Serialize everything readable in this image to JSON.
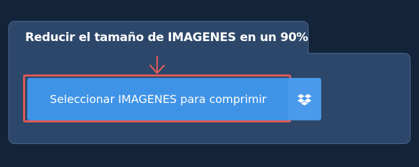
{
  "uploader": {
    "title": "Reducir el tamaño de IMAGENES en un 90%",
    "select_button_label": "Seleccionar IMAGENES para comprimir",
    "dropbox_icon": "dropbox-icon",
    "arrow_icon": "arrow-down-icon"
  },
  "colors": {
    "background": "#13233a",
    "panel": "#2c4769",
    "button": "#3f93e6",
    "highlight": "#dc5a5a"
  }
}
